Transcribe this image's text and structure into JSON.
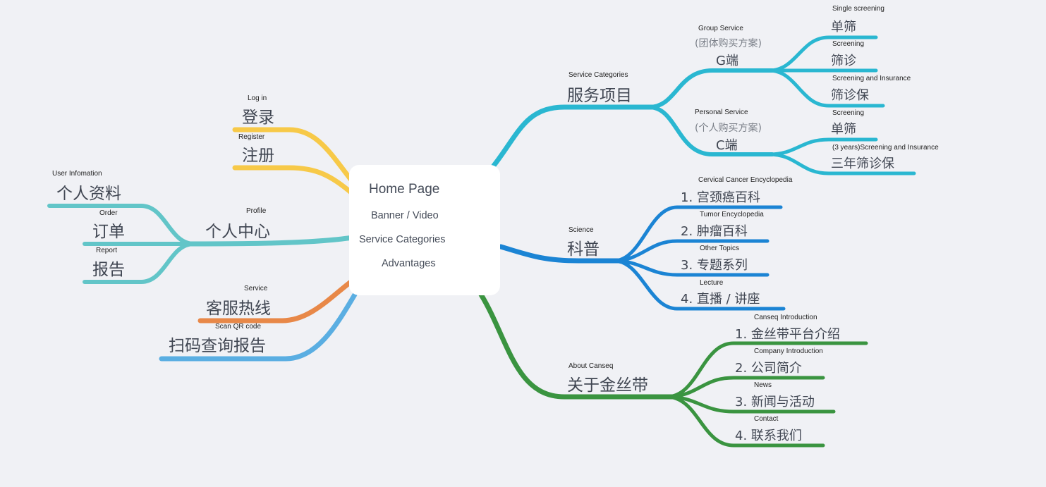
{
  "colors": {
    "background": "#f0f1f5",
    "yellow": "#f7c948",
    "teal": "#62c5c8",
    "orange": "#e88848",
    "lightblue": "#5aaee2",
    "cyan": "#2ab7d1",
    "blue": "#1b84d4",
    "green": "#3a9440"
  },
  "root": {
    "title": "Home Page",
    "items": [
      "Banner / Video",
      "Service Categories",
      "Advantages"
    ]
  },
  "left": {
    "login": {
      "cn": "登录",
      "en": "Log in"
    },
    "register": {
      "cn": "注册",
      "en": "Register"
    },
    "profile": {
      "cn": "个人中心",
      "en": "Profile",
      "children": [
        {
          "cn": "个人资料",
          "en": "User Infomation"
        },
        {
          "cn": "订单",
          "en": "Order"
        },
        {
          "cn": "报告",
          "en": "Report"
        }
      ]
    },
    "service": {
      "cn": "客服热线",
      "en": "Service"
    },
    "scan": {
      "cn": "扫码查询报告",
      "en": "Scan QR code"
    }
  },
  "right": {
    "services": {
      "cn": "服务项目",
      "en": "Service Categories",
      "g": {
        "en": "Group Service",
        "sub": "(团体购买方案)",
        "cn": "G端",
        "children": [
          {
            "cn": "单筛",
            "en": "Single screening"
          },
          {
            "cn": "筛诊",
            "en": "Screening"
          },
          {
            "cn": "筛诊保",
            "en": "Screening and Insurance"
          }
        ]
      },
      "c": {
        "en": "Personal Service",
        "sub": "(个人购买方案)",
        "cn": "C端",
        "children": [
          {
            "cn": "单筛",
            "en": "Screening"
          },
          {
            "cn": "三年筛诊保",
            "en": "(3 years)Screening and Insurance"
          }
        ]
      }
    },
    "science": {
      "cn": "科普",
      "en": "Science",
      "children": [
        {
          "cn": "1. 宫颈癌百科",
          "en": "Cervical Cancer Encyclopedia"
        },
        {
          "cn": "2. 肿瘤百科",
          "en": "Tumor Encyclopedia"
        },
        {
          "cn": "3. 专题系列",
          "en": "Other Topics"
        },
        {
          "cn": "4. 直播 / 讲座",
          "en": "Lecture"
        }
      ]
    },
    "about": {
      "cn": "关于金丝带",
      "en": "About Canseq",
      "children": [
        {
          "cn": "1. 金丝带平台介绍",
          "en": "Canseq Introduction"
        },
        {
          "cn": "2. 公司简介",
          "en": "Company Introduction"
        },
        {
          "cn": "3. 新闻与活动",
          "en": "News"
        },
        {
          "cn": "4. 联系我们",
          "en": "Contact"
        }
      ]
    }
  }
}
